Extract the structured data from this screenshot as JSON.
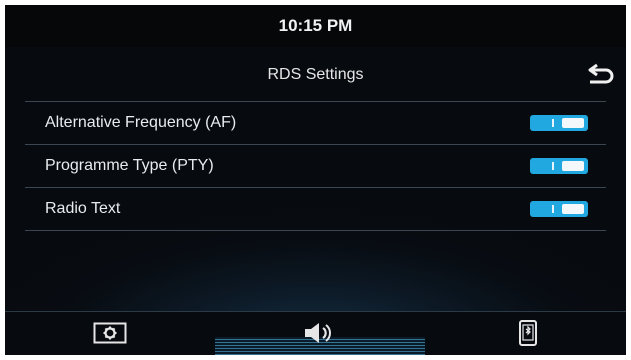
{
  "status": {
    "time": "10:15 PM"
  },
  "header": {
    "title": "RDS Settings",
    "back_icon": "back-arrow-icon"
  },
  "settings": [
    {
      "label": "Alternative Frequency (AF)",
      "enabled": true
    },
    {
      "label": "Programme Type (PTY)",
      "enabled": true
    },
    {
      "label": "Radio Text",
      "enabled": true
    }
  ],
  "footer": {
    "icons": [
      "settings-icon",
      "volume-icon",
      "phone-icon"
    ],
    "active_index": 1
  },
  "colors": {
    "accent": "#21a8e0",
    "background": "#080d13"
  }
}
